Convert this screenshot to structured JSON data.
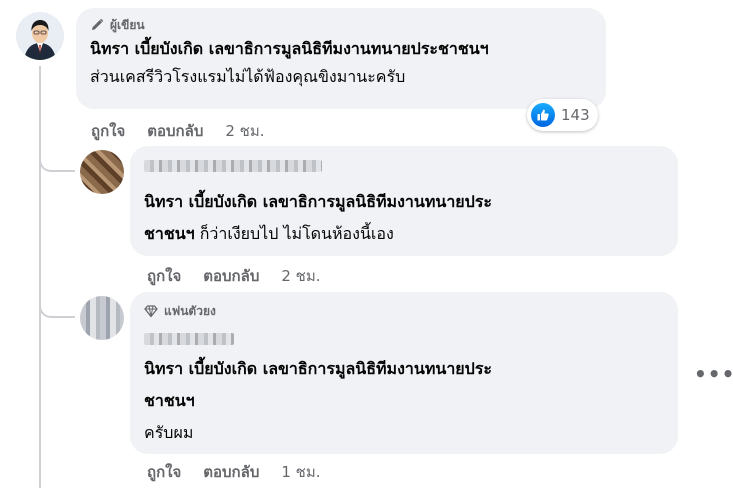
{
  "colors": {
    "bubble": "#f0f2f5",
    "like_blue": "#1877f2",
    "muted": "#65676b",
    "line": "#ced0d4"
  },
  "comments": [
    {
      "badge": "ผู้เขียน",
      "badge_icon": "pencil-icon",
      "author": "นิทรา เบี้ยบังเกิด เลขาธิการมูลนิธิทีมงานทนายประชาชนฯ",
      "text": "ส่วนเคสรีวิวโรงแรมไม่ได้ฟ้องคุณขิงมานะครับ",
      "like_label": "ถูกใจ",
      "reply_label": "ตอบกลับ",
      "time": "2 ชม.",
      "reactions": {
        "icon": "like-icon",
        "count": "143"
      }
    },
    {
      "mention": "นิทรา เบี้ยบังเกิด เลขาธิการมูลนิธิทีมงานทนายประ",
      "mention_cont": "ชาชนฯ",
      "text": " ก็ว่าเงียบไป ไม่โดนห้องนี้เอง",
      "like_label": "ถูกใจ",
      "reply_label": "ตอบกลับ",
      "time": "2 ชม."
    },
    {
      "badge": "แฟนตัวยง",
      "badge_icon": "diamond-icon",
      "mention": "นิทรา เบี้ยบังเกิด เลขาธิการมูลนิธิทีมงานทนายประ",
      "mention_cont": "ชาชนฯ",
      "text": "ครับผม",
      "like_label": "ถูกใจ",
      "reply_label": "ตอบกลับ",
      "time": "1 ชม.",
      "more_icon": "more-options-icon",
      "more_glyph": "•••"
    }
  ]
}
